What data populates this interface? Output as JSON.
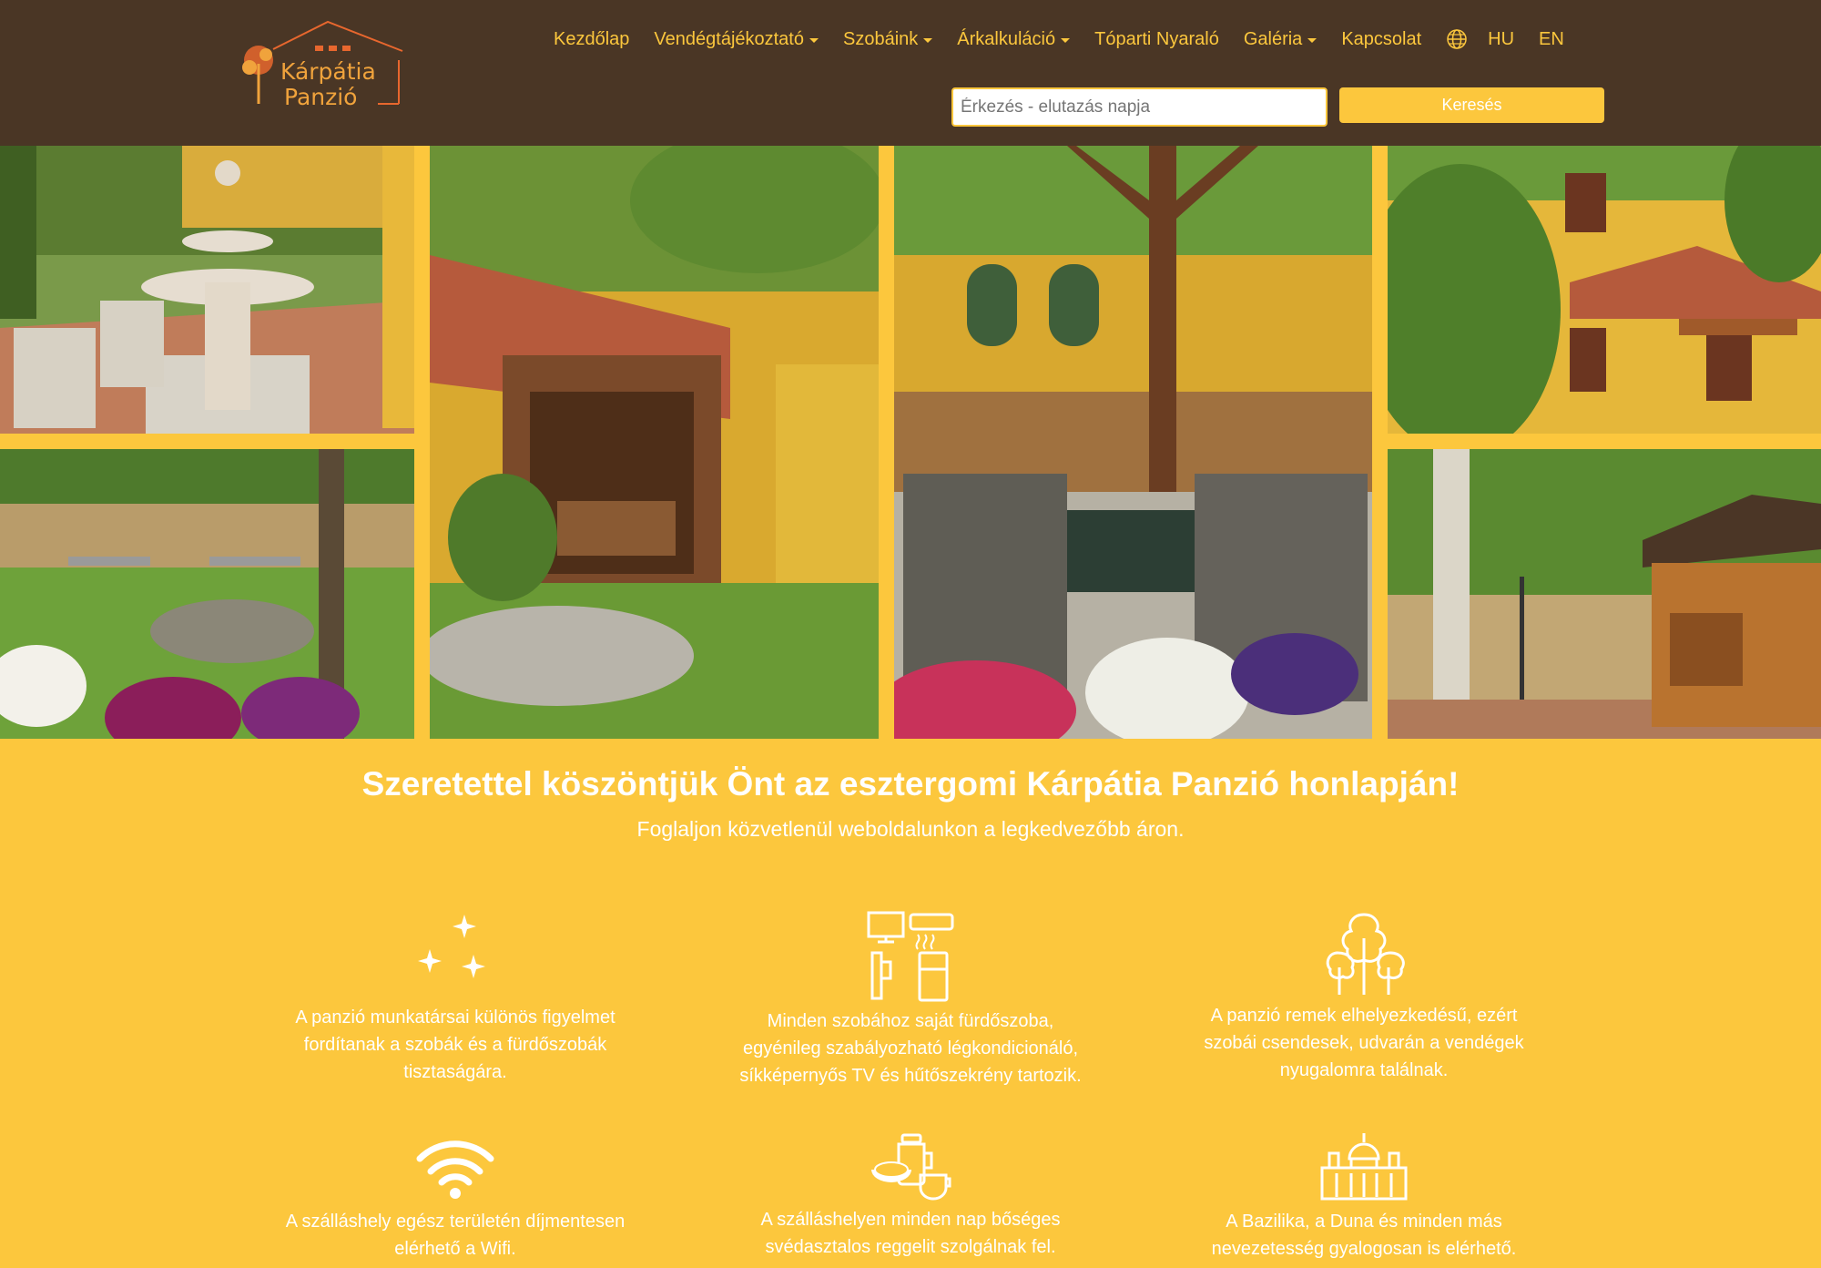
{
  "brand": {
    "logo_line1": "Kárpátia",
    "logo_line2": "Panzió"
  },
  "nav": {
    "items": [
      {
        "label": "Kezdőlap",
        "dropdown": false
      },
      {
        "label": "Vendégtájékoztató",
        "dropdown": true
      },
      {
        "label": "Szobáink",
        "dropdown": true
      },
      {
        "label": "Árkalkuláció",
        "dropdown": true
      },
      {
        "label": "Tóparti Nyaraló",
        "dropdown": false
      },
      {
        "label": "Galéria",
        "dropdown": true
      },
      {
        "label": "Kapcsolat",
        "dropdown": false
      }
    ],
    "lang_hu": "HU",
    "lang_en": "EN"
  },
  "search": {
    "placeholder": "Érkezés - elutazás napja",
    "button_label": "Keresés"
  },
  "gallery": {
    "photos": [
      "fountain-patio",
      "garden-pergola",
      "terrace-table",
      "house-exterior",
      "garden-lawn",
      "wooden-cottage"
    ]
  },
  "welcome": {
    "title": "Szeretettel köszöntjük Önt az esztergomi Kárpátia Panzió honlapján!",
    "subtitle": "Foglaljon közvetlenül weboldalunkon a legkedvezőbb áron."
  },
  "features": [
    {
      "icon": "sparkle-icon",
      "lines": [
        "A panzió munkatársai különös figyelmet",
        "fordítanak a szobák és a fürdőszobák",
        "tisztaságára."
      ]
    },
    {
      "icon": "room-amenities-icon",
      "lines": [
        "Minden szobához saját fürdőszoba,",
        "egyénileg szabályozható légkondicionáló,",
        "síkképernyős TV és hűtőszekrény tartozik."
      ]
    },
    {
      "icon": "trees-icon",
      "lines": [
        "A panzió remek elhelyezkedésű, ezért",
        "szobái csendesek, udvarán a vendégek",
        "nyugalomra találnak."
      ]
    },
    {
      "icon": "wifi-icon",
      "lines": [
        "A szálláshely egész területén díjmentesen",
        "elérhető a Wifi."
      ]
    },
    {
      "icon": "breakfast-icon",
      "lines": [
        "A szálláshelyen minden nap bőséges",
        "svédasztalos reggelit szolgálnak fel."
      ]
    },
    {
      "icon": "basilica-icon",
      "lines": [
        "A Bazilika, a Duna és minden más",
        "nevezetesség gyalogosan is elérhető."
      ]
    }
  ],
  "colors": {
    "header_bg": "#4a3625",
    "accent": "#fcc73d",
    "logo_orange": "#f0a33c"
  }
}
